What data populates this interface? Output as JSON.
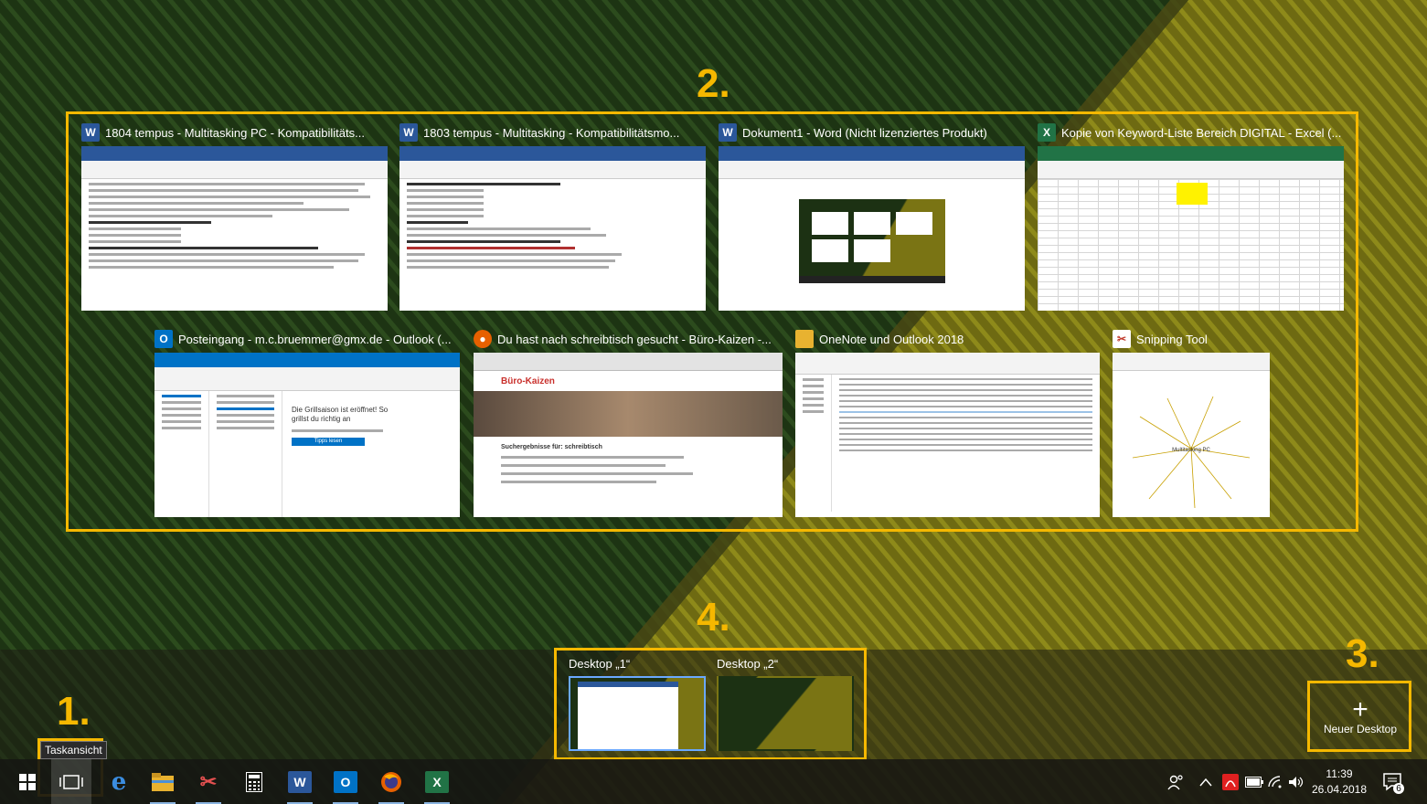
{
  "annotations": {
    "n1": "1.",
    "n2": "2.",
    "n3": "3.",
    "n4": "4."
  },
  "windows_row1": [
    {
      "title": "1804 tempus - Multitasking PC  -  Kompatibilitäts...",
      "app": "W",
      "color": "#2b579a",
      "icon": "word-icon"
    },
    {
      "title": "1803 tempus - Multitasking  -  Kompatibilitätsmo...",
      "app": "W",
      "color": "#2b579a",
      "icon": "word-icon"
    },
    {
      "title": "Dokument1 - Word (Nicht lizenziertes Produkt)",
      "app": "W",
      "color": "#2b579a",
      "icon": "word-icon"
    },
    {
      "title": "Kopie von Keyword-Liste Bereich DIGITAL - Excel (...",
      "app": "X",
      "color": "#217346",
      "icon": "excel-icon"
    }
  ],
  "windows_row2": [
    {
      "title": "Posteingang - m.c.bruemmer@gmx.de - Outlook (...",
      "app": "O",
      "color": "#0072c6",
      "icon": "outlook-icon"
    },
    {
      "title": "Du hast nach schreibtisch gesucht - Büro-Kaizen -...",
      "app": "●",
      "color": "#e66000",
      "icon": "firefox-icon"
    },
    {
      "title": "OneNote und Outlook 2018",
      "app": "▬",
      "color": "#e8b230",
      "icon": "folder-icon"
    },
    {
      "title": "Snipping Tool",
      "app": "✂",
      "color": "#c0392b",
      "icon": "snipping-tool-icon"
    }
  ],
  "thumb_text": {
    "kaizen_brand": "Büro-Kaizen",
    "kaizen_heading": "Suchergebnisse für: schreibtisch",
    "outlook_mail_heading": "Die Grillsaison ist eröffnet! So grillst du richtig an",
    "outlook_button": "Tipps lesen",
    "snipping_label": "Multitasking PC"
  },
  "desktops": [
    {
      "label": "Desktop „1“",
      "active": true
    },
    {
      "label": "Desktop „2“",
      "active": false
    }
  ],
  "new_desktop": {
    "plus": "+",
    "label": "Neuer Desktop"
  },
  "tooltip": "Taskansicht",
  "taskbar": [
    {
      "name": "start-button",
      "icon": "windows-logo-icon"
    },
    {
      "name": "task-view-button",
      "icon": "task-view-icon"
    },
    {
      "name": "edge-button",
      "icon": "edge-icon",
      "glyph": "e"
    },
    {
      "name": "file-explorer-button",
      "icon": "folder-icon"
    },
    {
      "name": "snipping-tool-button",
      "icon": "snipping-tool-icon",
      "glyph": "✂"
    },
    {
      "name": "calculator-button",
      "icon": "calculator-icon"
    },
    {
      "name": "word-button",
      "icon": "word-icon",
      "glyph": "W"
    },
    {
      "name": "outlook-button",
      "icon": "outlook-icon",
      "glyph": "O"
    },
    {
      "name": "firefox-button",
      "icon": "firefox-icon"
    },
    {
      "name": "excel-button",
      "icon": "excel-icon",
      "glyph": "X"
    }
  ],
  "clock": {
    "time": "11:39",
    "date": "26.04.2018"
  },
  "notification_count": "6",
  "colors": {
    "accent": "#f5b800",
    "word": "#2b579a",
    "excel": "#217346",
    "outlook": "#0072c6"
  }
}
